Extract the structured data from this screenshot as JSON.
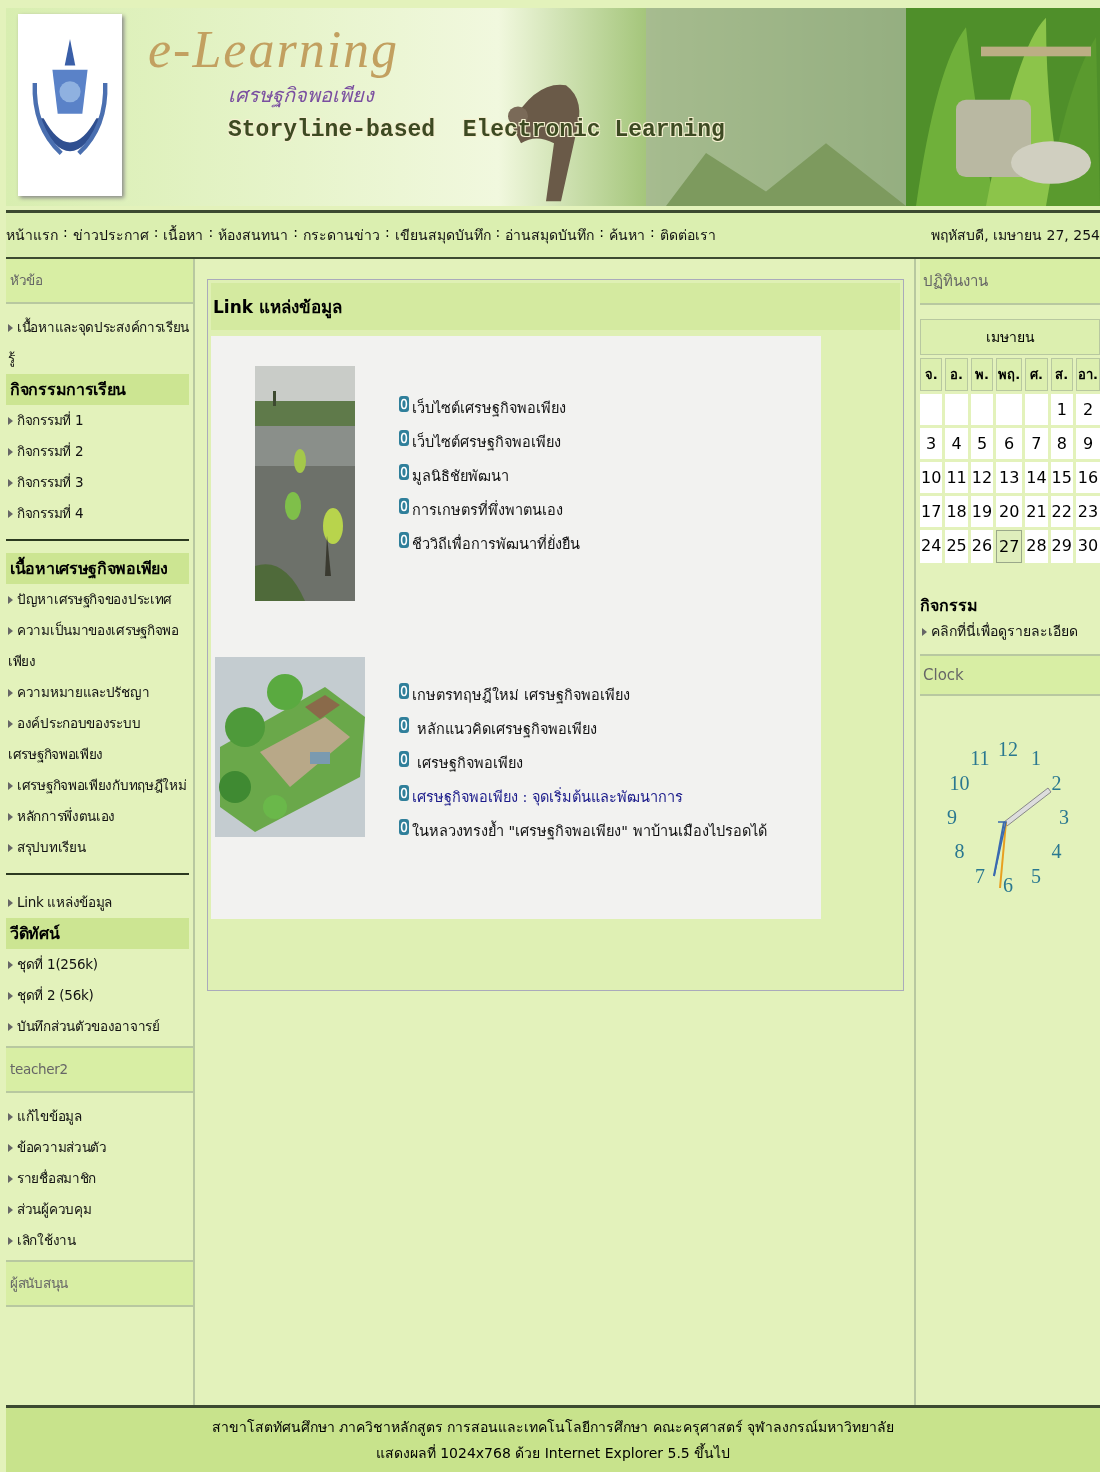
{
  "banner": {
    "title": "e-Learning",
    "subtitle": "เศรษฐกิจพอเพียง",
    "tagline": "Storyline-based  Electronic Learning"
  },
  "nav": {
    "items": [
      "หน้าแรก",
      "ข่าวประกาศ",
      "เนื้อหา",
      "ห้องสนทนา",
      "กระดานข่าว",
      "เขียนสมุดบันทึก",
      "อ่านสมุดบันทึก",
      "ค้นหา",
      "ติดต่อเรา"
    ],
    "separator": ":",
    "date": "พฤหัสบดี, เมษายน 27, 254"
  },
  "sidebar": {
    "items": [
      {
        "kind": "header",
        "text": "หัวข้อ"
      },
      {
        "kind": "link",
        "text": "เนื้อหาและจุดประสงค์การเรียนรู้"
      },
      {
        "kind": "section",
        "text": "กิจกรรมการเรียน"
      },
      {
        "kind": "link",
        "text": "กิจกรรมที่ 1"
      },
      {
        "kind": "link",
        "text": "กิจกรรมที่ 2"
      },
      {
        "kind": "link",
        "text": "กิจกรรมที่ 3"
      },
      {
        "kind": "link",
        "text": "กิจกรรมที่ 4"
      },
      {
        "kind": "divider"
      },
      {
        "kind": "section",
        "text": "เนื้อหาเศรษฐกิจพอเพียง"
      },
      {
        "kind": "link",
        "text": "ปัญหาเศรษฐกิจของประเทศ"
      },
      {
        "kind": "link",
        "text": "ความเป็นมาของเศรษฐกิจพอเพียง"
      },
      {
        "kind": "link",
        "text": "ความหมายและปรัชญา"
      },
      {
        "kind": "link",
        "text": "องค์ประกอบของระบบเศรษฐกิจพอเพียง"
      },
      {
        "kind": "link",
        "text": "เศรษฐกิจพอเพียงกับทฤษฎีใหม่"
      },
      {
        "kind": "link",
        "text": "หลักการพึ่งตนเอง"
      },
      {
        "kind": "link",
        "text": "สรุปบทเรียน"
      },
      {
        "kind": "divider"
      },
      {
        "kind": "link",
        "text": "Link แหล่งข้อมูล"
      },
      {
        "kind": "section",
        "text": "วีดิทัศน์"
      },
      {
        "kind": "link",
        "text": "ชุดที่ 1(256k)"
      },
      {
        "kind": "link",
        "text": "ชุดที่ 2 (56k)"
      },
      {
        "kind": "link",
        "text": "บันทึกส่วนตัวของอาจารย์"
      },
      {
        "kind": "header",
        "text": "teacher2"
      },
      {
        "kind": "link",
        "text": "แก้ไขข้อมูล"
      },
      {
        "kind": "link",
        "text": "ข้อความส่วนตัว"
      },
      {
        "kind": "link",
        "text": "รายชื่อสมาชิก"
      },
      {
        "kind": "link",
        "text": "ส่วนผู้ควบคุม"
      },
      {
        "kind": "link",
        "text": "เลิกใช้งาน"
      },
      {
        "kind": "header",
        "text": "ผู้สนับสนุน"
      }
    ]
  },
  "content": {
    "title": "Link แหล่งข้อมูล",
    "groups": [
      {
        "links": [
          {
            "text": "เว็บไซต์เศรษฐกิจพอเพียง",
            "visited": false
          },
          {
            "text": "เว็บไซต์ศรษฐกิจพอเพียง",
            "visited": false
          },
          {
            "text": "มูลนิธิชัยพัฒนา",
            "visited": false
          },
          {
            "text": "การเกษตรที่พึ่งพาตนเอง",
            "visited": false
          },
          {
            "text": "ชีววิถีเพื่อการพัฒนาที่ยั่งยืน",
            "visited": false
          }
        ]
      },
      {
        "links": [
          {
            "text": "เกษตรทฤษฎีใหม่ เศรษฐกิจพอเพียง",
            "visited": false
          },
          {
            "text": " หลักแนวคิดเศรษฐกิจพอเพียง",
            "visited": false
          },
          {
            "text": " เศรษฐกิจพอเพียง",
            "visited": false
          },
          {
            "text": "เศรษฐกิจพอเพียง : จุดเริ่มต้นและพัฒนาการ",
            "visited": true
          },
          {
            "text": "ในหลวงทรงย้ำ \"เศรษฐกิจพอเพียง\" พาบ้านเมืองไปรอดได้",
            "visited": false
          }
        ]
      }
    ]
  },
  "calendar": {
    "title": "ปฏิทินงาน",
    "month": "เมษายน",
    "weekdays": [
      "จ.",
      "อ.",
      "พ.",
      "พฤ.",
      "ศ.",
      "ส.",
      "อา."
    ],
    "weeks": [
      [
        {
          "d": "1",
          "selected": false
        },
        {
          "d": "2",
          "selected": false
        }
      ],
      [
        {
          "d": "3",
          "selected": false
        },
        {
          "d": "4",
          "selected": false
        },
        {
          "d": "5",
          "selected": false
        },
        {
          "d": "6",
          "selected": false
        },
        {
          "d": "7",
          "selected": false
        },
        {
          "d": "8",
          "selected": false
        },
        {
          "d": "9",
          "selected": false
        }
      ],
      [
        {
          "d": "10",
          "selected": false
        },
        {
          "d": "11",
          "selected": false
        },
        {
          "d": "12",
          "selected": false
        },
        {
          "d": "13",
          "selected": false
        },
        {
          "d": "14",
          "selected": false
        },
        {
          "d": "15",
          "selected": false
        },
        {
          "d": "16",
          "selected": false
        }
      ],
      [
        {
          "d": "17",
          "selected": false
        },
        {
          "d": "18",
          "selected": false
        },
        {
          "d": "19",
          "selected": false
        },
        {
          "d": "20",
          "selected": false
        },
        {
          "d": "21",
          "selected": false
        },
        {
          "d": "22",
          "selected": false
        },
        {
          "d": "23",
          "selected": false
        }
      ],
      [
        {
          "d": "24",
          "selected": false
        },
        {
          "d": "25",
          "selected": false
        },
        {
          "d": "26",
          "selected": false
        },
        {
          "d": "27",
          "selected": true
        },
        {
          "d": "28",
          "selected": false
        },
        {
          "d": "29",
          "selected": false
        },
        {
          "d": "30",
          "selected": false
        }
      ]
    ],
    "events_heading": "กิจกรรม",
    "events_link": "คลิกที่นี่เพื่อดูรายละเอียด"
  },
  "clock": {
    "title": "Clock",
    "numbers": [
      "12",
      "11",
      "1",
      "10",
      "2",
      "9",
      "3",
      "8",
      "4",
      "7",
      "5",
      "6"
    ]
  },
  "footer": {
    "lines": [
      "สาขาโสตทัศนศึกษา ภาควิชาหลักสูตร การสอนและเทคโนโลยีการศึกษา คณะครุศาสตร์ จุฬาลงกรณ์มหาวิทยาลัย",
      "แสดงผลที่ 1024x768 ด้วย Internet Explorer 5.5 ขึ้นไป"
    ]
  }
}
